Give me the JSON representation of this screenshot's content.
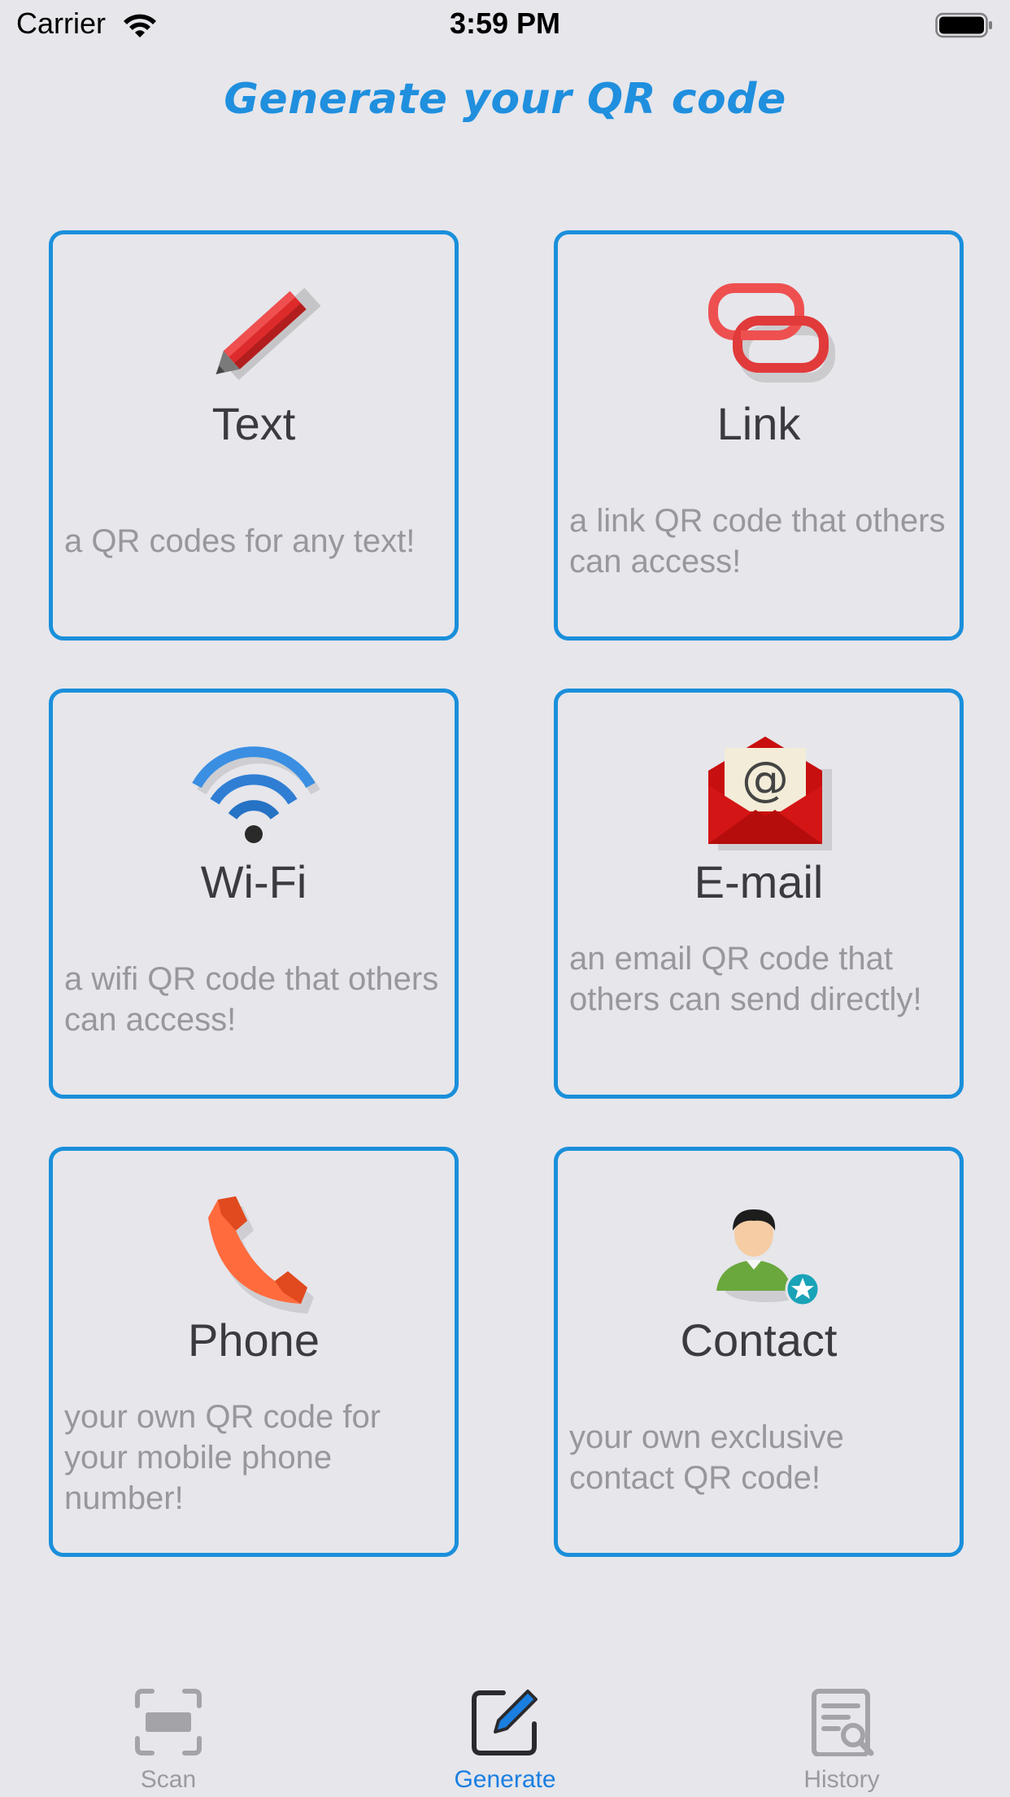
{
  "status_bar": {
    "carrier": "Carrier",
    "time": "3:59 PM"
  },
  "header": {
    "title": "Generate your QR code"
  },
  "cards": [
    {
      "title": "Text",
      "description": "a QR codes for any text!",
      "icon": "pencil-icon"
    },
    {
      "title": "Link",
      "description": "a link QR code that others can access!",
      "icon": "chain-link-icon"
    },
    {
      "title": "Wi-Fi",
      "description": "a wifi QR code that others can access!",
      "icon": "wifi-icon"
    },
    {
      "title": "E-mail",
      "description": "an email QR code that others can send directly!",
      "icon": "envelope-icon"
    },
    {
      "title": "Phone",
      "description": "your own QR code for your mobile phone number!",
      "icon": "phone-handset-icon"
    },
    {
      "title": "Contact",
      "description": "your own exclusive contact QR code!",
      "icon": "contact-person-icon"
    }
  ],
  "tab_bar": {
    "tabs": [
      {
        "label": "Scan",
        "icon": "scan-frame-icon",
        "active": false
      },
      {
        "label": "Generate",
        "icon": "edit-square-icon",
        "active": true
      },
      {
        "label": "History",
        "icon": "history-document-icon",
        "active": false
      }
    ]
  },
  "colors": {
    "accent": "#1a8fdb",
    "background": "#e6e6eb",
    "title_text": "#3a3a40",
    "description_text": "#97979c",
    "tab_inactive": "#9a9aa0",
    "tab_active": "#1a7fe0"
  }
}
